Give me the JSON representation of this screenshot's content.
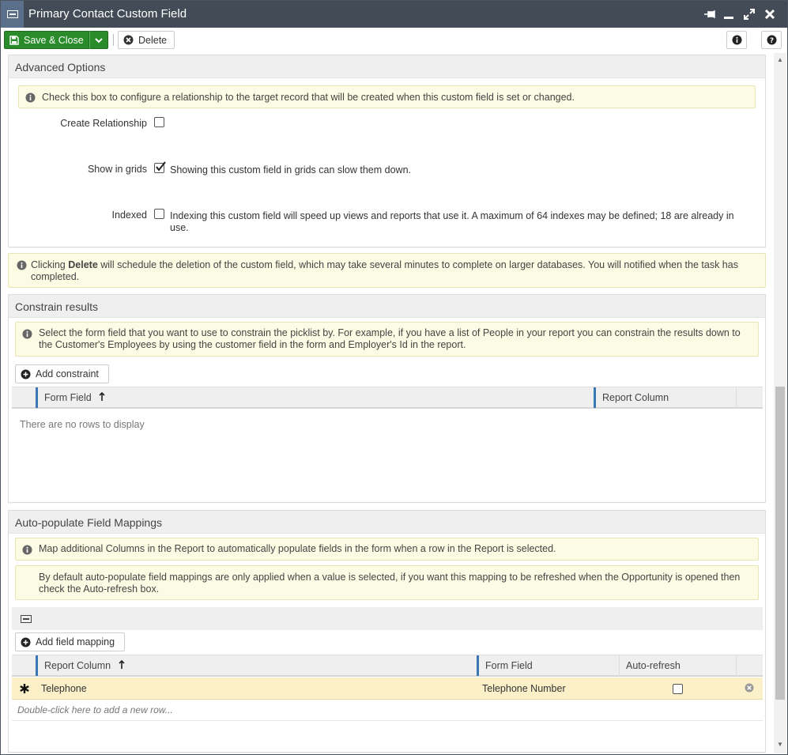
{
  "window": {
    "title": "Primary Contact Custom Field"
  },
  "toolbar": {
    "save_label": "Save & Close",
    "delete_label": "Delete"
  },
  "advanced": {
    "title": "Advanced Options",
    "note": "Check this box to configure a relationship to the target record that will be created when this custom field is set or changed.",
    "create_relationship": {
      "label": "Create Relationship",
      "checked": false
    },
    "show_in_grids": {
      "label": "Show in grids",
      "checked": true,
      "hint": "Showing this custom field in grids can slow them down."
    },
    "indexed": {
      "label": "Indexed",
      "checked": false,
      "hint": "Indexing this custom field will speed up views and reports that use it. A maximum of 64 indexes may be defined; 18 are already in use."
    }
  },
  "delete_note": {
    "pre": "Clicking ",
    "bold": "Delete",
    "post": " will schedule the deletion of the custom field, which may take several minutes to complete on larger databases. You will notified when the task has completed."
  },
  "constrain": {
    "title": "Constrain results",
    "note": "Select the form field that you want to use to constrain the picklist by. For example, if you have a list of People in your report you can constrain the results down to the Customer's Employees by using the customer field in the form and Employer's Id in the report.",
    "add_label": "Add constraint",
    "columns": [
      "Form Field",
      "Report Column"
    ],
    "empty": "There are no rows to display"
  },
  "autopop": {
    "title": "Auto-populate Field Mappings",
    "note1": "Map additional Columns in the Report to automatically populate fields in the form when a row in the Report is selected.",
    "note2": "By default auto-populate field mappings are only applied when a value is selected, if you want this mapping to be refreshed when the Opportunity is opened then check the Auto-refresh box.",
    "add_label": "Add field mapping",
    "columns": [
      "Report Column",
      "Form Field",
      "Auto-refresh"
    ],
    "rows": [
      {
        "report_column": "Telephone",
        "form_field": "Telephone Number",
        "auto_refresh": false
      }
    ],
    "new_row": "Double-click here to add a new row..."
  },
  "colors": {
    "titlebar": "#434c56",
    "save": "#2a8b2a",
    "note_bg": "#fcfbe3",
    "sort_accent": "#3a78b5",
    "row_highlight": "#fcf0c8"
  }
}
